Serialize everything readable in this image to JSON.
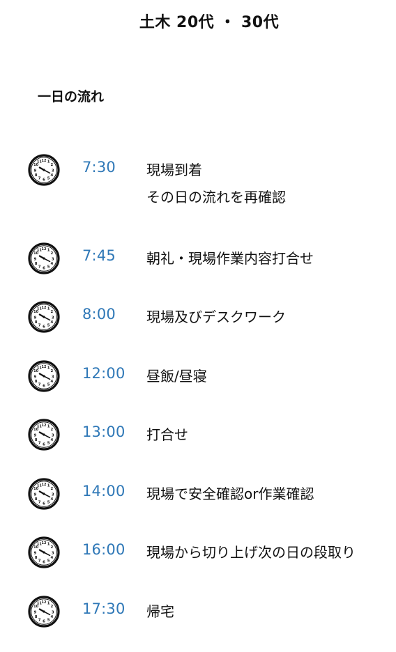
{
  "header": {
    "title": "土木 20代 ・ 30代"
  },
  "section": {
    "title": "一日の流れ"
  },
  "colors": {
    "time_text": "#2f78b7",
    "body_text": "#111111"
  },
  "schedule": [
    {
      "icon": "clock-icon",
      "time": "7:30",
      "lines": [
        "現場到着",
        "その日の流れを再確認"
      ]
    },
    {
      "icon": "clock-icon",
      "time": "7:45",
      "lines": [
        "朝礼・現場作業内容打合せ"
      ]
    },
    {
      "icon": "clock-icon",
      "time": "8:00",
      "lines": [
        "現場及びデスクワーク"
      ]
    },
    {
      "icon": "clock-icon",
      "time": "12:00",
      "lines": [
        "昼飯/昼寝"
      ]
    },
    {
      "icon": "clock-icon",
      "time": "13:00",
      "lines": [
        "打合せ"
      ]
    },
    {
      "icon": "clock-icon",
      "time": "14:00",
      "lines": [
        "現場で安全確認or作業確認"
      ]
    },
    {
      "icon": "clock-icon",
      "time": "16:00",
      "lines": [
        "現場から切り上げ次の日の段取り"
      ]
    },
    {
      "icon": "clock-icon",
      "time": "17:30",
      "lines": [
        "帰宅"
      ]
    }
  ]
}
